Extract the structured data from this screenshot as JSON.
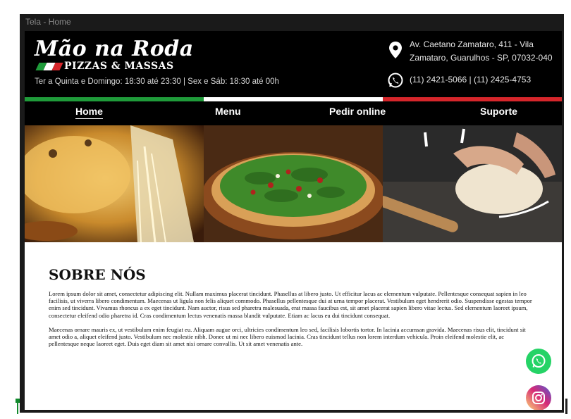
{
  "window": {
    "title": "Tela - Home"
  },
  "brand": {
    "name": "Mão na Roda",
    "tagline": "PIZZAS & MASSAS",
    "flag_colors": [
      "#1f9b3a",
      "#ffffff",
      "#d6262b"
    ]
  },
  "header": {
    "hours": "Ter a Quinta e Domingo: 18:30 até 23:30 | Sex e Sáb: 18:30 até 00h",
    "address_line1": "Av. Caetano Zamataro, 411 - Vila",
    "address_line2": "Zamataro, Guarulhos - SP, 07032-040",
    "phones": "(11) 2421-5066 | (11) 2425-4753",
    "address_icon": "map-pin-icon",
    "phone_icon": "whatsapp-phone-icon"
  },
  "nav": {
    "items": [
      "Home",
      "Menu",
      "Pedir online",
      "Suporte"
    ],
    "active": "Home"
  },
  "hero": {
    "images": [
      "cheese-pizza-slice",
      "arugula-pizza",
      "dough-kneading"
    ]
  },
  "about": {
    "title": "SOBRE NÓS",
    "paragraph1": "Lorem ipsum dolor sit amet, consectetur adipiscing elit. Nullam maximus placerat tincidunt. Phasellus at libero justo. Ut efficitur lacus ac elementum vulputate. Pellentesque consequat sapien in leo facilisis, ut viverra libero condimentum. Maecenas ut ligula non felis aliquet commodo. Phasellus pellentesque dui at urna tempor placerat. Vestibulum eget hendrerit odio. Suspendisse egestas tempor enim sed tincidunt. Vivamus rhoncus a ex eget tincidunt. Nam auctor, risus sed pharetra malesuada, erat massa faucibus est, sit amet placerat sapien libero vitae lectus. Sed elementum laoreet ipsum, consectetur eleifend odio pharetra id. Cras condimentum lectus venenatis massa blandit vulputate. Etiam ac lacus eu dui tincidunt consequat.",
    "paragraph2": "Maecenas ornare mauris ex, ut vestibulum enim feugiat eu. Aliquam augue orci, ultricies condimentum leo sed, facilisis lobortis tortor. In lacinia accumsan gravida. Maecenas risus elit, tincidunt sit amet odio a, aliquet eleifend justo. Vestibulum nec molestie nibh. Donec ut mi nec libero euismod lacinia. Cras tincidunt tellus non lorem interdum vehicula. Proin eleifend molestie elit, ac pellentesque neque laoreet eget. Duis eget diam sit amet nisi ornare convallis. Ut sit amet venenatis ante."
  },
  "social": {
    "whatsapp_color": "#25d366",
    "instagram_colors": [
      "#feda75",
      "#d62976",
      "#4f5bd5"
    ]
  }
}
